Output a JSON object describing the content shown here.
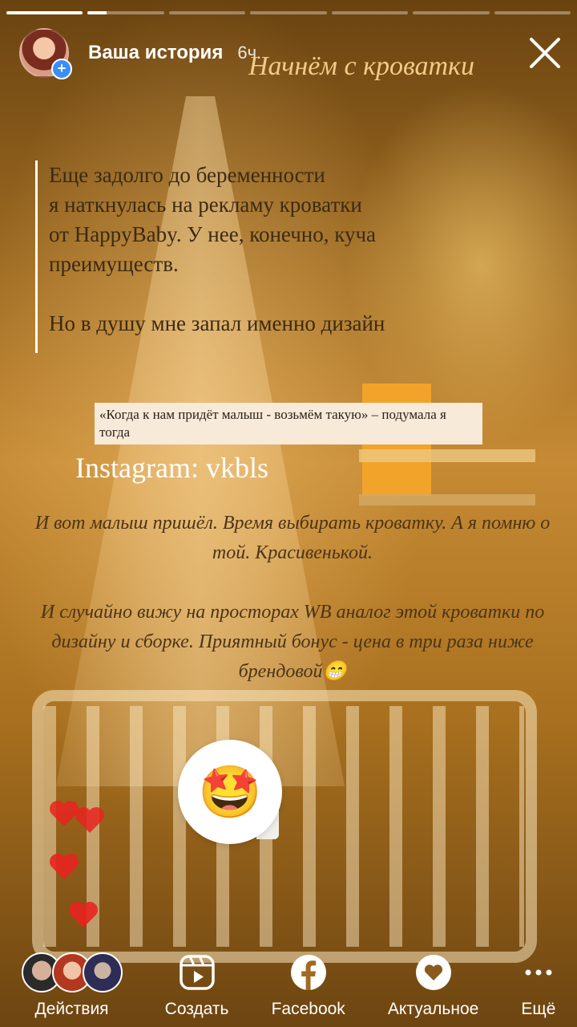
{
  "progress": [
    1.0,
    0.25,
    0,
    0,
    0,
    0,
    0
  ],
  "header": {
    "name": "Ваша история",
    "time": "6ч."
  },
  "story": {
    "title": "Начнём с кроватки",
    "quote_lines_1": [
      "Еще задолго до беременности",
      "я наткнулась на рекламу кроватки",
      "от HappyBaby. У нее, конечно, куча",
      "преимуществ."
    ],
    "quote_line_2": "Но в душу мне запал именно дизайн",
    "sticker": "«Когда к нам придёт малыш - возьмём такую» – подумала я тогда",
    "instagram": "Instagram: vkbls",
    "para1": "И вот малыш пришёл. Время выбирать кроватку. А я помню о той. Красивенькой.",
    "para2": "И случайно вижу на просторах WB аналог этой кроватки по дизайну и сборке. Приятный бонус - цена в три раза ниже брендовой😁",
    "reaction_emoji": "🤩"
  },
  "bottom": {
    "actions": "Действия",
    "create": "Создать",
    "facebook": "Facebook",
    "highlights": "Актуальное",
    "more": "Ещё"
  },
  "colors": {
    "accent_title": "#f1cc89",
    "heart": "#e8231f",
    "plus_badge": "#3a8ef6"
  }
}
